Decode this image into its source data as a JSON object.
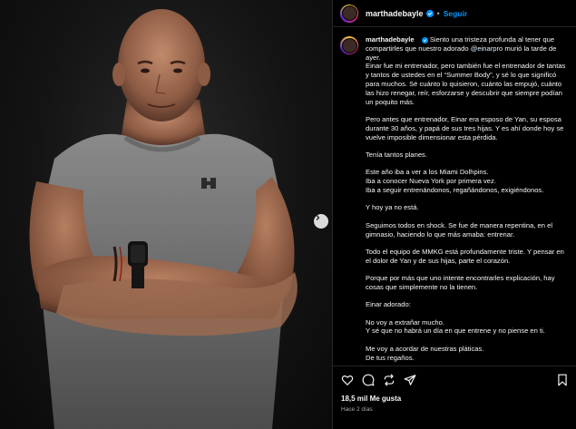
{
  "post": {
    "username": "marthadebayle",
    "follow_label": "Seguir",
    "separator": "•",
    "caption_intro": "Siento una tristeza profunda al tener que compartirles que nuestro adorado",
    "caption_mention": "@einarpro",
    "caption_intro_end": "murió la tarde de ayer.",
    "paragraphs": [
      "Einar fue mi entrenador, pero también fue el entrenador de tantas y tantos de ustedes en el “Summer Body”, y sé lo que significó para muchos. Sé cuánto lo quisieron, cuánto las empujó, cuánto las hizo renegar, reír, esforzarse y descubrir que siempre podían un poquito más.",
      "Pero antes que entrenador, Einar era esposo de Yan, su esposa durante 30 años, y papá de sus tres hijas. Y es ahí donde hoy se vuelve imposible dimensionar esta pérdida.",
      "Tenía tantos planes.",
      "Este año iba a ver a los Miami Dolhpins.",
      "Iba a conocer Nueva York por primera vez.",
      "Iba a seguir entrenándonos, regañándonos, exigiéndonos.",
      "Y hoy ya no está.",
      "Seguimos todos en shock. Se fue de manera repentina, en el gimnasio, haciendo lo que más amaba: entrenar.",
      "Todo el equipo de MMKG está profundamente triste. Y pensar en el dolor de Yan y de sus hijas, parte el corazón.",
      "Porque por más que uno intente encontrarles explicación, hay cosas que simplemente no la tienen.",
      "Einar adorado:",
      "No voy a extrañar mucho.",
      "Y sé que no habrá un día en que entrene y no piense en ti.",
      "Me voy a acordar de nuestras pláticas.",
      "De tus regaños."
    ],
    "likes": "18,5 mil Me gusta",
    "time_ago": "Hace 2 días"
  },
  "icons": {
    "verified": "verified-badge-icon",
    "next": "chevron-right-icon",
    "like": "heart-icon",
    "comment": "comment-icon",
    "repost": "repost-icon",
    "share": "send-icon",
    "save": "bookmark-icon"
  },
  "colors": {
    "accent": "#0095f6",
    "background": "#000000",
    "text": "#f5f5f5",
    "muted": "#a8a8a8"
  }
}
